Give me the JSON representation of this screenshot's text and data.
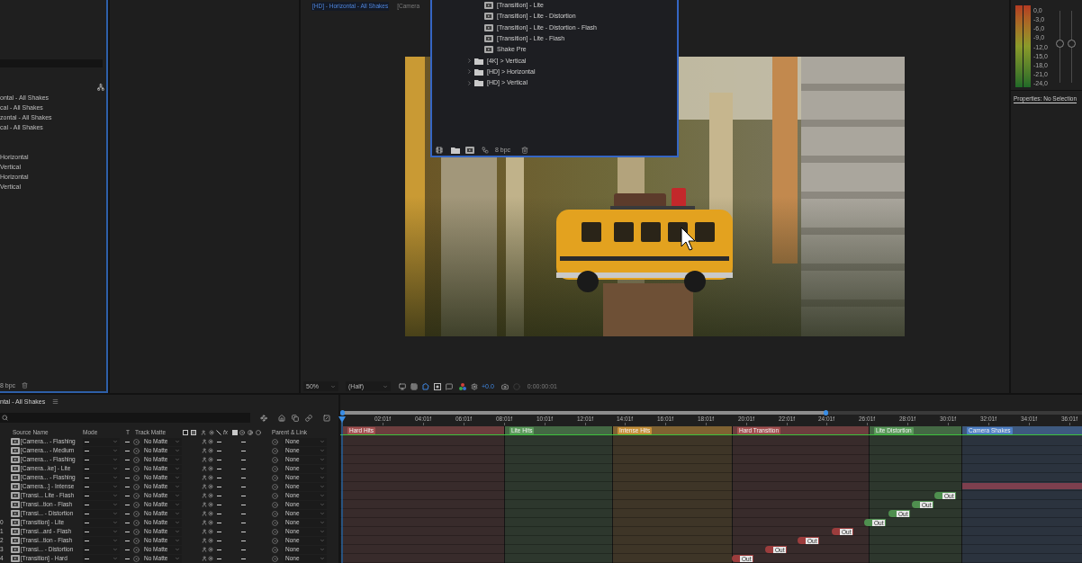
{
  "project_panel": {
    "compositions": [
      "ontal - All Shakes",
      "cal - All Shakes",
      "zontal - All Shakes",
      "cal - All Shakes"
    ],
    "folders": [
      "Horizontal",
      "Vertical",
      "Horizontal",
      "Vertical"
    ],
    "bit_depth": "8 bpc"
  },
  "project_window": {
    "items": [
      {
        "kind": "comp",
        "label": "[Transition] - Lite"
      },
      {
        "kind": "comp",
        "label": "[Transition] - Lite - Distortion"
      },
      {
        "kind": "comp",
        "label": "[Transition] - Lite - Distortion - Flash"
      },
      {
        "kind": "comp",
        "label": "[Transition] - Lite - Flash"
      },
      {
        "kind": "comp",
        "label": "Shake Pre"
      },
      {
        "kind": "folder",
        "label": "[4K] > Vertical",
        "expanded": false
      },
      {
        "kind": "folder",
        "label": "[HD] > Horizontal",
        "expanded": false
      },
      {
        "kind": "folder",
        "label": "[HD] > Vertical",
        "expanded": false
      }
    ],
    "bit_depth": "8 bpc"
  },
  "viewer": {
    "tabs": [
      {
        "label": "[HD] - Horizontal - All Shakes",
        "selected": true
      },
      {
        "label": "[Camera",
        "selected": false
      }
    ],
    "magnification": "50%",
    "resolution": "(Half)",
    "exposure": "+0.0",
    "timecode": "0:00:00:01"
  },
  "audio": {
    "scale": [
      "0,0",
      "-3,0",
      "-6,0",
      "-9,0",
      "-12,0",
      "-15,0",
      "-18,0",
      "-21,0",
      "-24,0"
    ],
    "sliders": [
      {
        "level": 0.54
      },
      {
        "level": 0.54
      }
    ]
  },
  "properties": {
    "tab": "Properties: No Selection"
  },
  "timeline": {
    "tab": "ntal - All Shakes",
    "columns": {
      "source_name": "Source Name",
      "mode": "Mode",
      "t": "T",
      "track_matte": "Track Matte",
      "effects": "fx",
      "parent": "Parent & Link"
    },
    "layers": [
      {
        "name": "[Camera... - Flashing",
        "track_matte": "No Matte",
        "parent": "None"
      },
      {
        "name": "[Camera... - Medium",
        "track_matte": "No Matte",
        "parent": "None"
      },
      {
        "name": "[Camera... - Flashing",
        "track_matte": "No Matte",
        "parent": "None"
      },
      {
        "name": "[Camera...ke] - Lite",
        "track_matte": "No Matte",
        "parent": "None"
      },
      {
        "name": "[Camera... - Flashing",
        "track_matte": "No Matte",
        "parent": "None"
      },
      {
        "name": "[Camera...] - Intense",
        "track_matte": "No Matte",
        "parent": "None",
        "track": {
          "kind": "bar"
        }
      },
      {
        "name": "[Transi... Lite - Flash",
        "track_matte": "No Matte",
        "parent": "None",
        "track": {
          "kind": "tag",
          "label": "Out",
          "color": "#4f8f4f"
        }
      },
      {
        "name": "[Transi...tion - Flash",
        "track_matte": "No Matte",
        "parent": "None",
        "track": {
          "kind": "tag",
          "label": "Out",
          "color": "#4f8f4f"
        }
      },
      {
        "name": "[Transi... - Distortion",
        "track_matte": "No Matte",
        "parent": "None",
        "track": {
          "kind": "tag",
          "label": "Out",
          "color": "#4f8f4f"
        }
      },
      {
        "number": "0",
        "name": "[Transition] - Lite",
        "track_matte": "No Matte",
        "parent": "None",
        "track": {
          "kind": "tag",
          "label": "Out",
          "color": "#4f8f4f"
        }
      },
      {
        "number": "1",
        "name": "[Transi...ard - Flash",
        "track_matte": "No Matte",
        "parent": "None",
        "track": {
          "kind": "tag",
          "label": "Out",
          "color": "#9c3d3d"
        }
      },
      {
        "number": "2",
        "name": "[Transi...tion - Flash",
        "track_matte": "No Matte",
        "parent": "None",
        "track": {
          "kind": "tag",
          "label": "Out",
          "color": "#9c3d3d"
        }
      },
      {
        "number": "3",
        "name": "[Transi... - Distortion",
        "track_matte": "No Matte",
        "parent": "None",
        "track": {
          "kind": "tag",
          "label": "Out",
          "color": "#9c3d3d"
        }
      },
      {
        "number": "4",
        "name": "[Transition] - Hard",
        "track_matte": "No Matte",
        "parent": "None",
        "track": {
          "kind": "tag",
          "label": "Out",
          "color": "#9c3d3d"
        }
      }
    ],
    "ruler": [
      "02:01f",
      "04:01f",
      "06:01f",
      "08:01f",
      "10:01f",
      "12:01f",
      "14:01f",
      "16:01f",
      "18:01f",
      "20:01f",
      "22:01f",
      "24:01f",
      "26:01f",
      "28:01f",
      "30:01f",
      "32:01f",
      "34:01f",
      "36:01f"
    ],
    "markers": [
      {
        "label": "Hard Hits",
        "color": "#a24f4f"
      },
      {
        "label": "Lite Hits",
        "color": "#5a9a5a"
      },
      {
        "label": "Intense Hits",
        "color": "#c48f38"
      },
      {
        "label": "Hard Transition",
        "color": "#a24f4f"
      },
      {
        "label": "Lite Distortion",
        "color": "#5a9a5a"
      },
      {
        "label": "Camera Shakes",
        "color": "#4e7fc4"
      }
    ]
  }
}
